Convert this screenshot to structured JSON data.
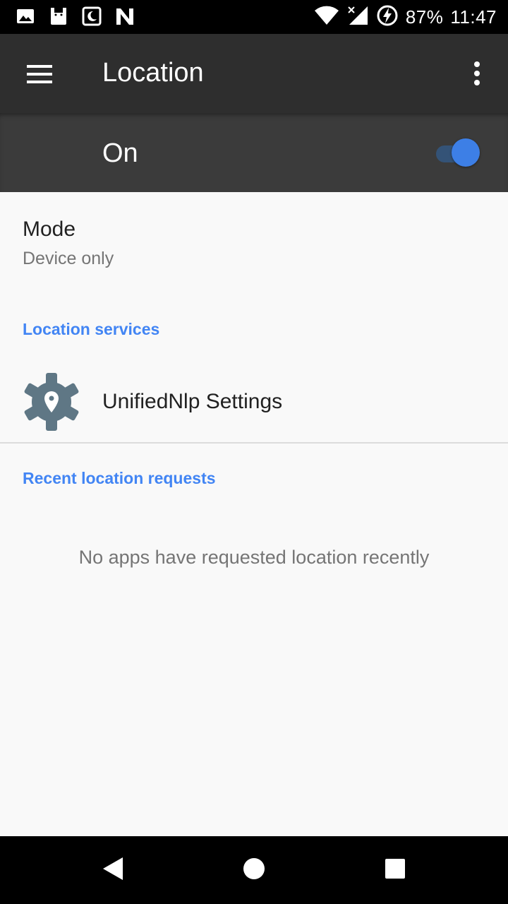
{
  "status_bar": {
    "battery": "87%",
    "time": "11:47",
    "left_icons": [
      "image-icon",
      "android-icon",
      "moon-icon",
      "n-icon"
    ],
    "right_icons": [
      "wifi-icon",
      "signal-icon",
      "battery-charging-icon"
    ]
  },
  "toolbar": {
    "title": "Location",
    "menu_icon": "menu-icon",
    "overflow_icon": "more-vert-icon"
  },
  "master_switch": {
    "label": "On",
    "checked": true,
    "accent": "#3d7fe6"
  },
  "mode": {
    "title": "Mode",
    "summary": "Device only"
  },
  "location_services": {
    "header": "Location services",
    "items": [
      {
        "label": "UnifiedNlp Settings",
        "icon": "gear-location-icon"
      }
    ]
  },
  "recent_requests": {
    "header": "Recent location requests",
    "empty_text": "No apps have requested location recently"
  },
  "colors": {
    "header_blue": "#4285f4",
    "toolbar": "#2e2e2e",
    "switch_bar": "#3b3b3b"
  },
  "nav_bar": {
    "back_icon": "back-icon",
    "home_icon": "home-icon",
    "recents_icon": "recents-icon"
  }
}
